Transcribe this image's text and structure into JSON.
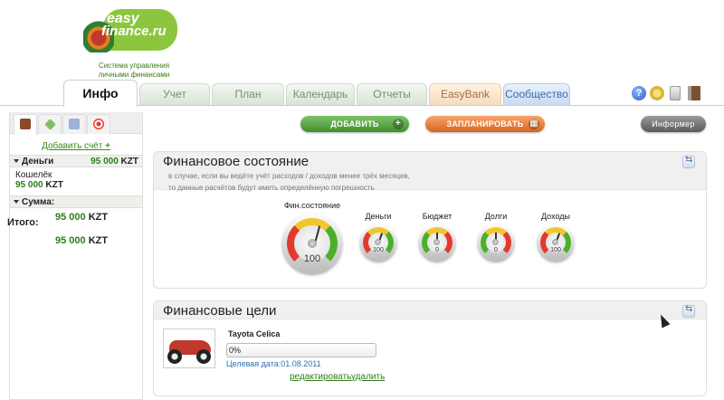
{
  "logo": {
    "line1": "easy",
    "line2": "finance.ru"
  },
  "slogan": {
    "line1": "Система управления",
    "line2": "личными финансами"
  },
  "tabs": [
    {
      "label": "Инфо"
    },
    {
      "label": "Учет"
    },
    {
      "label": "План"
    },
    {
      "label": "Календарь"
    },
    {
      "label": "Отчеты"
    },
    {
      "label": "EasyBank"
    },
    {
      "label": "Сообщество"
    }
  ],
  "top_icons": {
    "help": "?"
  },
  "sidebar": {
    "add_account": "Добавить счёт",
    "add_plus": "+",
    "money": {
      "label": "Деньги",
      "amount": "95 000",
      "currency": "KZT"
    },
    "account": {
      "name": "Кошелёк",
      "amount": "95 000",
      "currency": "KZT"
    },
    "sum": {
      "label": "Сумма:",
      "amount": "95 000",
      "currency": "KZT"
    },
    "total": {
      "label": "Итого:",
      "amount": "95 000",
      "currency": "KZT"
    }
  },
  "actions": {
    "add": "ДОБАВИТЬ",
    "add_sym": "+",
    "plan": "ЗАПЛАНИРОВАТЬ",
    "plan_sym": "▦",
    "informer": "Информер"
  },
  "finance_state": {
    "title": "Финансовое состояние",
    "note1": "в случае, если вы ведёте учёт расходов / доходов менее трёх месяцев,",
    "note2": "то данные расчётов будут иметь определённую погрешность",
    "gauges": [
      {
        "label": "Фин.состояние",
        "value": "100",
        "level": 1.0
      },
      {
        "label": "Деньги",
        "value": "100",
        "level": 1.0
      },
      {
        "label": "Бюджет",
        "value": "0",
        "level": 0.0
      },
      {
        "label": "Долги",
        "value": "0",
        "level": 0.0
      },
      {
        "label": "Доходы",
        "value": "100",
        "level": 1.0
      }
    ]
  },
  "goals": {
    "title": "Финансовые цели",
    "item": {
      "name": "Tayota Celica",
      "progress_text": "0%",
      "progress": 0,
      "date": "Целевая дата:01.08.2011",
      "edit": "редактировать",
      "delete": "удалить"
    }
  },
  "colors": {
    "accent_green": "#3e8e2a",
    "accent_orange": "#d6641e",
    "link_blue": "#2f6eb5"
  }
}
